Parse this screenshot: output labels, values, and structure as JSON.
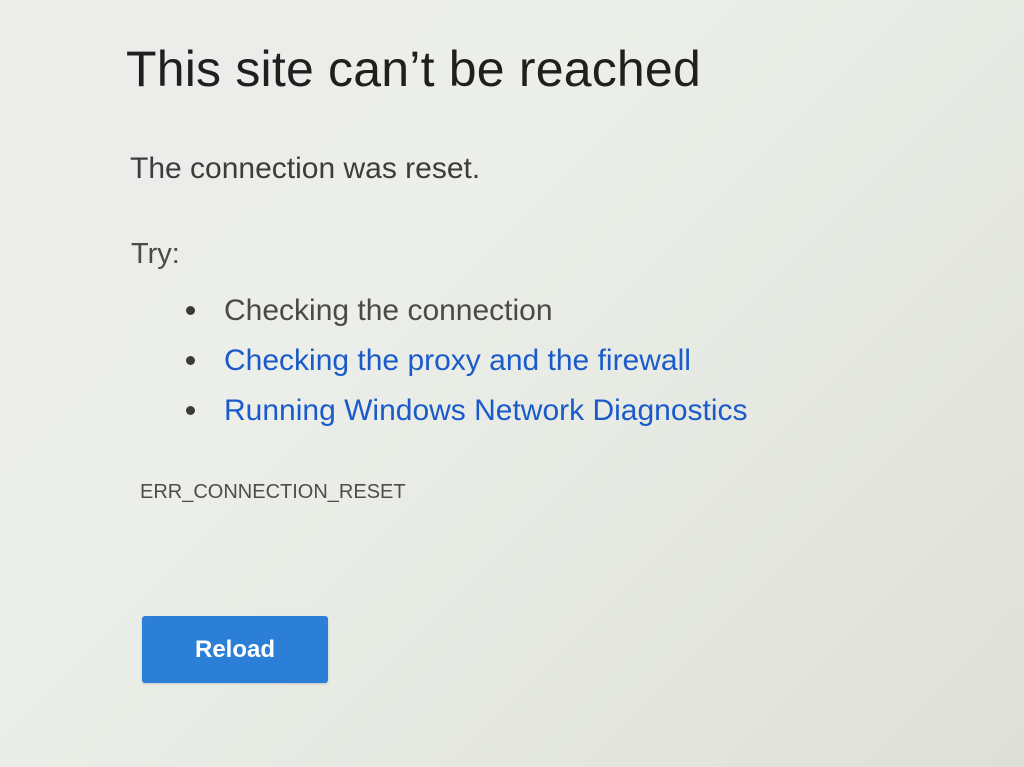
{
  "error_page": {
    "title": "This site can’t be reached",
    "subtitle": "The connection was reset.",
    "try_label": "Try:",
    "suggestions": [
      {
        "label": "Checking the connection",
        "is_link": false
      },
      {
        "label": "Checking the proxy and the firewall",
        "is_link": true
      },
      {
        "label": "Running Windows Network Diagnostics",
        "is_link": true
      }
    ],
    "error_code": "ERR_CONNECTION_RESET",
    "reload_label": "Reload"
  },
  "colors": {
    "link": "#1a5bc9",
    "button": "#2c7fd6",
    "text": "#202124"
  }
}
